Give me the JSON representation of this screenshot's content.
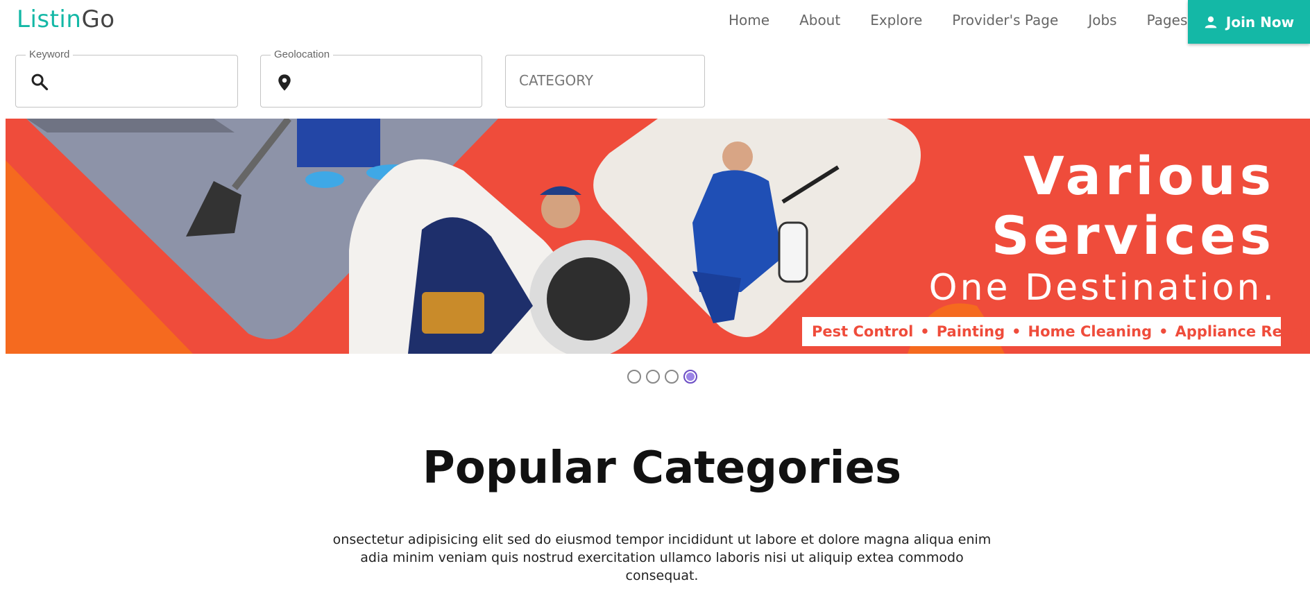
{
  "brand": {
    "part1": "Listin",
    "part2": "Go"
  },
  "nav": {
    "items": [
      "Home",
      "About",
      "Explore",
      "Provider's Page",
      "Jobs",
      "Pages"
    ],
    "join_label": "Join Now"
  },
  "search": {
    "keyword_label": "Keyword",
    "geolocation_label": "Geolocation",
    "category_placeholder": "CATEGORY"
  },
  "banner": {
    "title_line1": "Various",
    "title_line2": "Services",
    "tagline": "One Destination.",
    "services": [
      "Pest Control",
      "Painting",
      "Home Cleaning",
      "Appliance Repair"
    ],
    "colors": {
      "primary": "#ef4c3b",
      "secondary": "#f56a1f"
    }
  },
  "carousel": {
    "slides": 4,
    "active_index": 3
  },
  "popular": {
    "title": "Popular Categories",
    "description": "onsectetur adipisicing elit sed do eiusmod tempor incididunt ut labore et dolore magna aliqua enim adia minim veniam quis nostrud exercitation ullamco laboris nisi ut aliquip extea commodo consequat."
  },
  "theme": {
    "accent": "#14b8a6",
    "dot_active": "#9b84e6"
  }
}
